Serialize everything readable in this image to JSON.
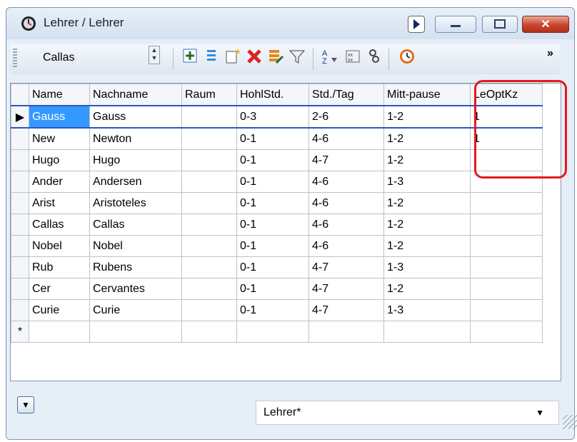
{
  "window": {
    "title": "Lehrer / Lehrer"
  },
  "toolbar": {
    "selected_teacher": "Callas",
    "icons": [
      "grid-add-icon",
      "list-icon",
      "new-record-icon",
      "delete-icon",
      "edit-records-icon",
      "filter-icon",
      "sort-icon",
      "field-layout-icon",
      "teacher-link-icon",
      "clock-icon"
    ],
    "more_label": "»"
  },
  "table": {
    "headers": [
      "Name",
      "Nachname",
      "Raum",
      "HohlStd.",
      "Std./Tag",
      "Mitt-pause",
      "LeOptKz"
    ],
    "rows": [
      {
        "name": "Gauss",
        "nachname": "Gauss",
        "raum": "",
        "hohl": "0-3",
        "stdtag": "2-6",
        "mittpause": "1-2",
        "leoptkz": "1"
      },
      {
        "name": "New",
        "nachname": "Newton",
        "raum": "",
        "hohl": "0-1",
        "stdtag": "4-6",
        "mittpause": "1-2",
        "leoptkz": "1"
      },
      {
        "name": "Hugo",
        "nachname": "Hugo",
        "raum": "",
        "hohl": "0-1",
        "stdtag": "4-7",
        "mittpause": "1-2",
        "leoptkz": ""
      },
      {
        "name": "Ander",
        "nachname": "Andersen",
        "raum": "",
        "hohl": "0-1",
        "stdtag": "4-6",
        "mittpause": "1-3",
        "leoptkz": ""
      },
      {
        "name": "Arist",
        "nachname": "Aristoteles",
        "raum": "",
        "hohl": "0-1",
        "stdtag": "4-6",
        "mittpause": "1-2",
        "leoptkz": ""
      },
      {
        "name": "Callas",
        "nachname": "Callas",
        "raum": "",
        "hohl": "0-1",
        "stdtag": "4-6",
        "mittpause": "1-2",
        "leoptkz": ""
      },
      {
        "name": "Nobel",
        "nachname": "Nobel",
        "raum": "",
        "hohl": "0-1",
        "stdtag": "4-6",
        "mittpause": "1-2",
        "leoptkz": ""
      },
      {
        "name": "Rub",
        "nachname": "Rubens",
        "raum": "",
        "hohl": "0-1",
        "stdtag": "4-7",
        "mittpause": "1-3",
        "leoptkz": ""
      },
      {
        "name": "Cer",
        "nachname": "Cervantes",
        "raum": "",
        "hohl": "0-1",
        "stdtag": "4-7",
        "mittpause": "1-2",
        "leoptkz": ""
      },
      {
        "name": "Curie",
        "nachname": "Curie",
        "raum": "",
        "hohl": "0-1",
        "stdtag": "4-7",
        "mittpause": "1-3",
        "leoptkz": ""
      }
    ],
    "current_row_marker": "▶",
    "new_row_marker": "*"
  },
  "status": {
    "view": "Lehrer*"
  },
  "colors": {
    "selection": "#3399ff",
    "highlight": "#e31b1b",
    "close": "#c8452c"
  }
}
